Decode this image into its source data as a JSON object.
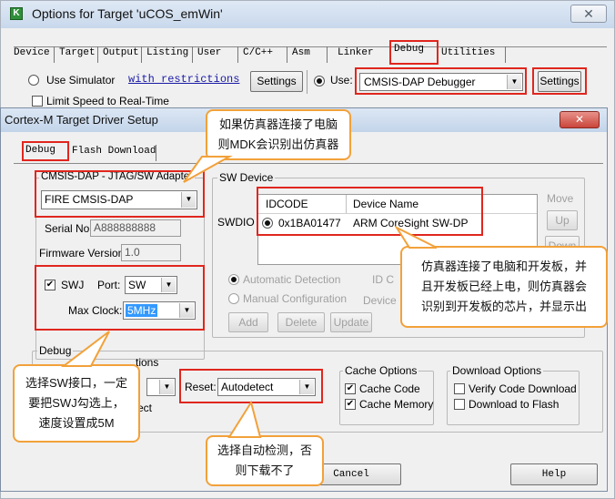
{
  "outer_window": {
    "title": "Options for Target 'uCOS_emWin'",
    "app_icon": "keil-uvision-icon",
    "close_glyph": "✕",
    "tabs": [
      "Device",
      "Target",
      "Output",
      "Listing",
      "User",
      "C/C++",
      "Asm",
      "Linker",
      "Debug",
      "Utilities"
    ],
    "use_simulator_label": "Use Simulator",
    "with_restrictions_link": "with restrictions",
    "limit_speed_label": "Limit Speed to Real-Time",
    "settings_left_label": "Settings",
    "use_label": "Use:",
    "debugger_value": "CMSIS-DAP Debugger",
    "settings_right_label": "Settings"
  },
  "inner_dialog": {
    "title": "Cortex-M Target Driver Setup",
    "close_glyph": "✕",
    "tabs": [
      "Debug",
      "Flash Download"
    ],
    "adapter": {
      "group_label": "CMSIS-DAP - JTAG/SW Adapter",
      "selected": "FIRE CMSIS-DAP",
      "serial_label": "Serial No:",
      "serial_value": "A888888888",
      "firmware_label": "Firmware Version:",
      "firmware_value": "1.0",
      "swj_label": "SWJ",
      "swj_checked": true,
      "port_label": "Port:",
      "port_value": "SW",
      "max_clock_label": "Max Clock:",
      "max_clock_value": "5MHz"
    },
    "sw_device": {
      "group_label": "SW Device",
      "swdio_label": "SWDIO",
      "columns": [
        "IDCODE",
        "Device Name"
      ],
      "rows": [
        {
          "idcode": "0x1BA01477",
          "device_name": "ARM CoreSight SW-DP"
        }
      ],
      "move_label": "Move",
      "up_label": "Up",
      "down_label": "Down",
      "auto_detect_label": "Automatic Detection",
      "manual_config_label": "Manual Configuration",
      "id_label": "ID C",
      "device_label": "Device",
      "add_label": "Add",
      "delete_label": "Delete",
      "update_label": "Update"
    },
    "debug_group": {
      "group_label": "Debug",
      "connect_partial": "tions",
      "connect_value_partial": "",
      "reset_label": "Reset:",
      "reset_value": "Autodetect",
      "verify_partial": "ect"
    },
    "cache_options": {
      "group_label": "Cache Options",
      "cache_code_label": "Cache Code",
      "cache_memory_label": "Cache Memory",
      "cache_code_checked": true,
      "cache_memory_checked": true
    },
    "download_options": {
      "group_label": "Download Options",
      "verify_label": "Verify Code Download",
      "download_flash_label": "Download to Flash"
    },
    "cancel_label": "Cancel",
    "help_label": "Help"
  },
  "annotations": {
    "callout_debugger": "如果仿真器连接了电脑\n则MDK会识别出仿真器",
    "callout_chip": "仿真器连接了电脑和开发板，并\n且开发板已经上电，则仿真器会\n识别到开发板的芯片，并显示出",
    "callout_swj": "选择SW接口，一定\n要把SWJ勾选上，\n速度设置成5M",
    "callout_reset": "选择自动检测，否\n则下载不了",
    "highlight_color": "#e0261e",
    "callout_border_color": "#f2a13a"
  },
  "colors": {
    "inner_title_bg": "#cfdcec",
    "selection_blue": "#3399ff",
    "link_blue": "#1a1aa6"
  }
}
